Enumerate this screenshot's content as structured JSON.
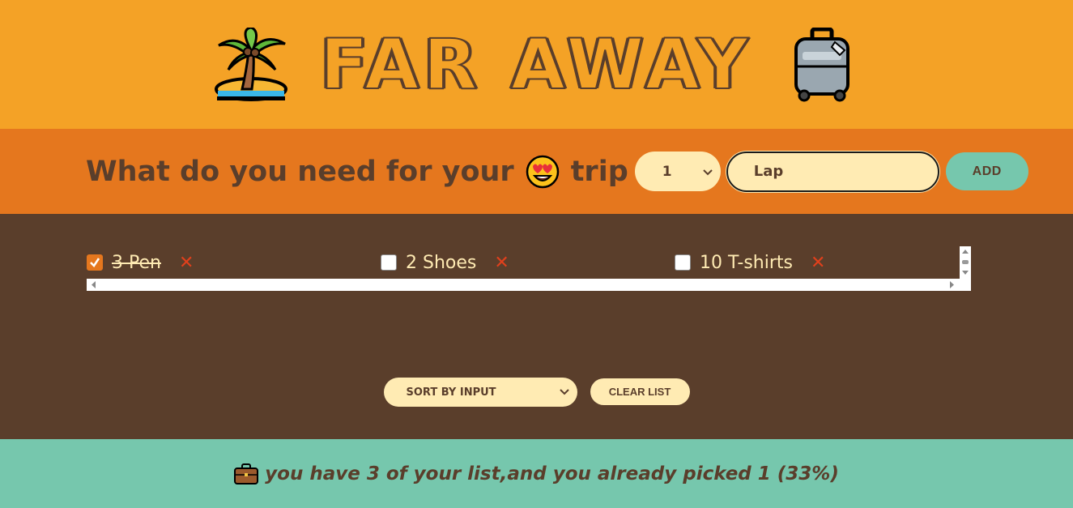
{
  "header": {
    "title": "FAR AWAY",
    "left_icon": "palm-island-icon",
    "right_icon": "luggage-icon"
  },
  "form": {
    "question": "What do you need for your",
    "question_end": "trip",
    "emoji": "heart-eyes-face-icon",
    "quantity_value": "1",
    "item_value": "Lap",
    "add_label": "ADD"
  },
  "items": [
    {
      "text": "3 Pen",
      "packed": true
    },
    {
      "text": "2 Shoes",
      "packed": false
    },
    {
      "text": "10 T-shirts",
      "packed": false
    }
  ],
  "actions": {
    "sort_value": "SORT BY INPUT",
    "clear_label": "CLEAR LIST"
  },
  "stats": {
    "text": "you have 3 of your list,and you already picked 1 (33%)",
    "icon": "briefcase-icon"
  },
  "colors": {
    "header_bg": "#f4a226",
    "form_bg": "#e5771e",
    "list_bg": "#5a3e2b",
    "stats_bg": "#76c7ad",
    "cream": "#ffebb3"
  }
}
